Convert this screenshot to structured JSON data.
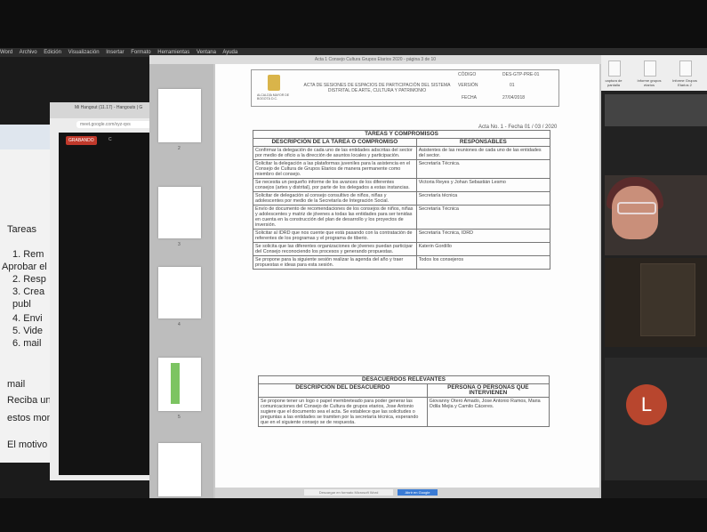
{
  "menubar": {
    "items": [
      "Word",
      "Archivo",
      "Edición",
      "Visualización",
      "Insertar",
      "Formato",
      "Herramientas",
      "Ventana",
      "Ayuda"
    ]
  },
  "word_doc": {
    "lines": [
      "Tareas",
      "1.  Rem",
      "Aprobar el p",
      "2.  Resp",
      "3.  Crea",
      "    publ",
      "4.  Envi",
      "5.  Vide",
      "6.  mail",
      "mail",
      "Reciba un c",
      "estos mome",
      "El motivo de"
    ]
  },
  "chrome": {
    "tab": "Mi Hangout (11.17) - Hangouts | G",
    "url": "meet.google.com/xyz-qvs",
    "record_button": "GRABANDO"
  },
  "pdf": {
    "window_title": "Acta 1 Consejo Cultura Grupos Etarios 2020 - página 3 de 10",
    "header": {
      "org": "ALCALDÍA MAYOR DE BOGOTÁ D.C.",
      "title": "ACTA DE SESIONES DE ESPACIOS DE PARTICIPACIÓN DEL SISTEMA DISTRITAL DE ARTE, CULTURA Y PATRIMONIO",
      "code_label": "CÓDIGO",
      "code_value": "DES-GTP-PRE-01",
      "version_label": "VERSIÓN",
      "version_value": "01",
      "date_label": "FECHA",
      "date_value": "27/04/2018"
    },
    "acta_ref": "Acta No. 1 - Fecha 01 / 03 / 2020",
    "tasks": {
      "title": "TAREAS Y COMPROMISOS",
      "col1": "DESCRIPCIÓN DE LA TAREA O COMPROMISO",
      "col2": "RESPONSABLES",
      "rows": [
        [
          "Confirmar la delegación de cada uno de las entidades adscritas del sector por medio de oficio a la dirección de asuntos locales y participación.",
          "Asistentes de las reuniones de cada uno de las entidades del sector."
        ],
        [
          "Solicitar la delegación a las plataformas juveniles para la asistencia en el Consejo de Cultura de Grupos Etarios de manera permanente como miembro del consejo.",
          "Secretaría Técnica."
        ],
        [
          "Se necesita un pequeño informe de los avances de los diferentes consejos (artes y distrital), por parte de los delegados a estas instancias.",
          "Victoria Reyes y Johan Sebastián Lesmo"
        ],
        [
          "Solicitar de delegación al consejo consultivo de niños, niñas y adolescentes por medio de la Secretaría de Integración Social.",
          "Secretaría técnica"
        ],
        [
          "Envío de documento de recomendaciones de los consejos de niños, niñas y adolescentes y matriz de jóvenes a todas las entidades para ser tenidas en cuenta en la construcción del plan de desarrollo y los proyectos de inversión.",
          "Secretaría Técnica"
        ],
        [
          "Solicitar al IDRD que nos cuente que está pasando con la contratación de referentes de los programas y el programa de tiberio.",
          "Secretaría Técnica, IDRD"
        ],
        [
          "Se solicita que las diferentes organizaciones de jóvenes puedan participar del Consejo reconociendo los procesos y generando propuestas.",
          "Katerin Gordillo"
        ],
        [
          "Se propone para la siguiente sesión realizar la agenda del año y traer propuestas e ideas para esta sesión.",
          "Todos los consejeros"
        ]
      ]
    },
    "disagreements": {
      "title": "DESACUERDOS RELEVANTES",
      "col1": "DESCRIPCIÓN DEL DESACUERDO",
      "col2": "PERSONA O PERSONAS QUE INTERVIENEN",
      "rows": [
        [
          "Se propone tener un logo o papel membreteado para poder generar las comunicaciones del Consejo de Cultura de grupos etarios, Jose Antonio sugiere que el documento sea el acta. Se establece que las solicitudes o preguntas a las entidades se tramiten por la secretaría técnica, esperando que en el siguiente consejo se de respuesta.",
          "Giovanny Otero Amado, Jose Antonio Ramos, Maria Odila Mejia y Camilo Cáceres."
        ]
      ]
    },
    "bottom_buttons": [
      "Descargar en formato Microsoft Word",
      "Abrir en Google"
    ],
    "thumb_numbers": [
      "2",
      "3",
      "4",
      "5",
      "6"
    ]
  },
  "desktop_icons": [
    "captura de pantalla",
    "Informe grupos etarios",
    "Informe Grupos Etarios 2"
  ],
  "participant_avatar": "L",
  "colors": {
    "avatar": "#b8462e",
    "record": "#c0392b",
    "pdf_button": "#3a7bd5"
  }
}
